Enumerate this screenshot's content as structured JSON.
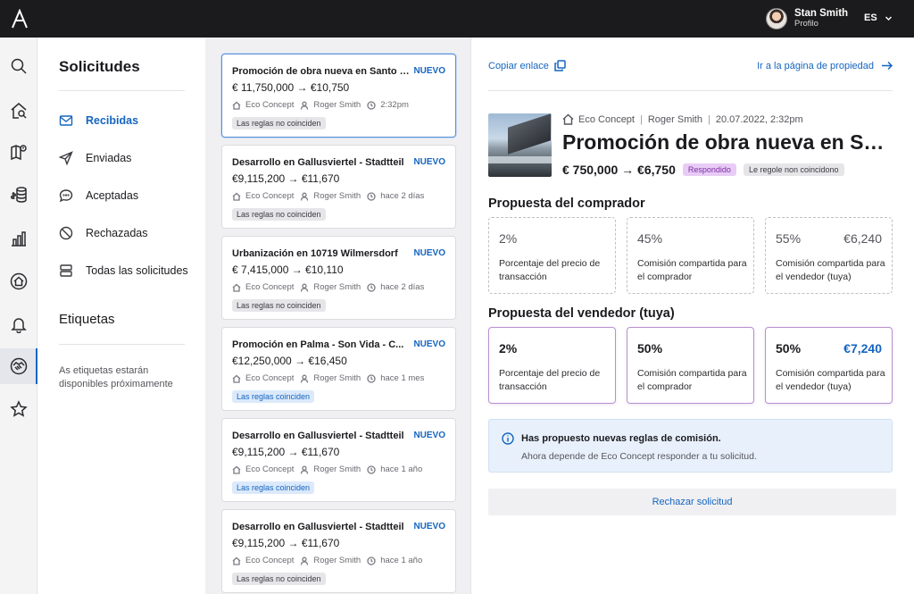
{
  "topbar": {
    "user_name": "Stan Smith",
    "user_sub": "Profilo",
    "language": "ES"
  },
  "rail": {
    "icons": [
      "search-icon",
      "house-search-icon",
      "map-pin-icon",
      "coins-icon",
      "chart-icon",
      "house-circle-icon",
      "bell-icon",
      "handshake-icon",
      "star-icon"
    ],
    "active_index": 7
  },
  "sidebar": {
    "title": "Solicitudes",
    "items": [
      {
        "label": "Recibidas",
        "icon": "mail-icon",
        "active": true
      },
      {
        "label": "Enviadas",
        "icon": "send-icon",
        "active": false
      },
      {
        "label": "Aceptadas",
        "icon": "chat-icon",
        "active": false
      },
      {
        "label": "Rechazadas",
        "icon": "blocked-icon",
        "active": false
      },
      {
        "label": "Todas las solicitudes",
        "icon": "stack-icon",
        "active": false
      }
    ],
    "tags_title": "Etiquetas",
    "tags_note": "As etiquetas estarán disponibles próximamente"
  },
  "requests": [
    {
      "title": "Promoción de obra nueva en Santo Est...",
      "badge": "NUEVO",
      "price": "€ 11,750,000 → €10,750",
      "company": "Eco Concept",
      "agent": "Roger Smith",
      "time": "2:32pm",
      "rule": "Las reglas no coinciden",
      "match": false
    },
    {
      "title": "Desarrollo en Gallusviertel - Stadtteil",
      "badge": "NUEVO",
      "price": "€9,115,200 → €11,670",
      "company": "Eco Concept",
      "agent": "Roger Smith",
      "time": "hace 2 días",
      "rule": "Las reglas no coinciden",
      "match": false
    },
    {
      "title": "Urbanización en 10719 Wilmersdorf",
      "badge": "NUEVO",
      "price": "€ 7,415,000 → €10,110",
      "company": "Eco Concept",
      "agent": "Roger Smith",
      "time": "hace 2 días",
      "rule": "Las reglas no coinciden",
      "match": false
    },
    {
      "title": "Promoción en Palma - Son Vida - C...",
      "badge": "NUEVO",
      "price": "€12,250,000 → €16,450",
      "company": "Eco Concept",
      "agent": "Roger Smith",
      "time": "hace 1 mes",
      "rule": "Las reglas coinciden",
      "match": true
    },
    {
      "title": "Desarrollo en Gallusviertel - Stadtteil",
      "badge": "NUEVO",
      "price": "€9,115,200 → €11,670",
      "company": "Eco Concept",
      "agent": "Roger Smith",
      "time": "hace 1 año",
      "rule": "Las reglas coinciden",
      "match": true
    },
    {
      "title": "Desarrollo en Gallusviertel - Stadtteil",
      "badge": "NUEVO",
      "price": "€9,115,200 → €11,670",
      "company": "Eco Concept",
      "agent": "Roger Smith",
      "time": "hace 1 año",
      "rule": "Las reglas no coinciden",
      "match": false
    }
  ],
  "detail": {
    "copy_link": "Copiar enlace",
    "go_link": "Ir a la página de propiedad",
    "company": "Eco Concept",
    "agent": "Roger Smith",
    "datetime": "20.07.2022, 2:32pm",
    "title": "Promoción de obra nueva en San...",
    "price": "€ 750,000 → €6,750",
    "status_tag": "Respondido",
    "rule_tag": "Le regole non coincidono",
    "buyer_title": "Propuesta del comprador",
    "buyer_boxes": [
      {
        "value": "2%",
        "value2": "",
        "label": "Porcentaje del precio de transacción"
      },
      {
        "value": "45%",
        "value2": "",
        "label": "Comisión compartida para el comprador"
      },
      {
        "value": "55%",
        "value2": "€6,240",
        "label": "Comisión compartida para el vendedor (tuya)"
      }
    ],
    "seller_title": "Propuesta del vendedor (tuya)",
    "seller_boxes": [
      {
        "value": "2%",
        "value2": "",
        "label": "Porcentaje del precio de transacción"
      },
      {
        "value": "50%",
        "value2": "",
        "label": "Comisión compartida para el comprador"
      },
      {
        "value": "50%",
        "value2": "€7,240",
        "label": "Comisión compartida para el vendedor (tuya)"
      }
    ],
    "info_title": "Has propuesto nuevas reglas de comisión.",
    "info_text": "Ahora depende de Eco Concept responder a tu solicitud.",
    "reject_label": "Rechazar solicitud"
  },
  "colors": {
    "accent": "#1565c0",
    "topbar": "#1b1b1d",
    "responded_tag": "#e9ccf6"
  }
}
